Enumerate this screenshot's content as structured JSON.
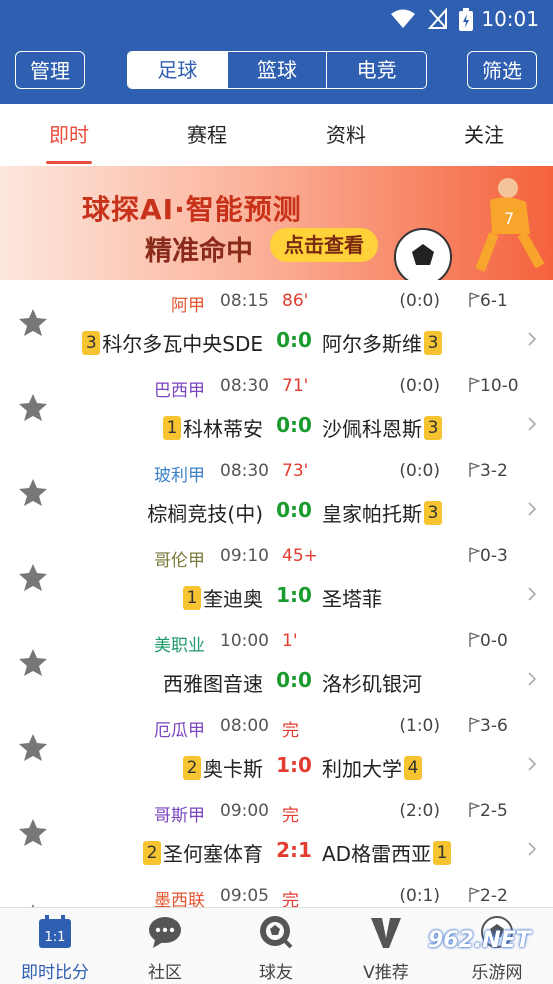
{
  "status_bar": {
    "time": "10:01"
  },
  "header": {
    "manage_label": "管理",
    "filter_label": "筛选",
    "sports": [
      "足球",
      "篮球",
      "电竞"
    ]
  },
  "tabs": [
    "即时",
    "赛程",
    "资料",
    "关注"
  ],
  "banner": {
    "line1": "球探AI·智能预测",
    "line2": "精准命中",
    "cta": "点击查看"
  },
  "matches": [
    {
      "league": "阿甲",
      "league_color": "#e2542f",
      "time": "08:15",
      "minute": "86'",
      "half": "(0:0)",
      "corner": "6-1",
      "home_badge": "3",
      "home": "科尔多瓦中央SDE",
      "score": "0:0",
      "away": "阿尔多斯维",
      "away_badge": "3",
      "finished": false
    },
    {
      "league": "巴西甲",
      "league_color": "#7b45c0",
      "time": "08:30",
      "minute": "71'",
      "half": "(0:0)",
      "corner": "10-0",
      "home_badge": "1",
      "home": "科林蒂安",
      "score": "0:0",
      "away": "沙佩科恩斯",
      "away_badge": "3",
      "finished": false
    },
    {
      "league": "玻利甲",
      "league_color": "#3c82c8",
      "time": "08:30",
      "minute": "73'",
      "half": "(0:0)",
      "corner": "3-2",
      "home_badge": "",
      "home": "棕榈竞技(中)",
      "score": "0:0",
      "away": "皇家帕托斯",
      "away_badge": "3",
      "finished": false
    },
    {
      "league": "哥伦甲",
      "league_color": "#7a7a3a",
      "time": "09:10",
      "minute": "45+",
      "half": "",
      "corner": "0-3",
      "home_badge": "1",
      "home": "奎迪奥",
      "score": "1:0",
      "away": "圣塔菲",
      "away_badge": "",
      "finished": false
    },
    {
      "league": "美职业",
      "league_color": "#1e9a6a",
      "time": "10:00",
      "minute": "1'",
      "half": "",
      "corner": "0-0",
      "home_badge": "",
      "home": "西雅图音速",
      "score": "0:0",
      "away": "洛杉矶银河",
      "away_badge": "",
      "finished": false
    },
    {
      "league": "厄瓜甲",
      "league_color": "#7b45c0",
      "time": "08:00",
      "minute": "完",
      "half": "(1:0)",
      "corner": "3-6",
      "home_badge": "2",
      "home": "奥卡斯",
      "score": "1:0",
      "away": "利加大学",
      "away_badge": "4",
      "finished": true
    },
    {
      "league": "哥斯甲",
      "league_color": "#7b45c0",
      "time": "09:00",
      "minute": "完",
      "half": "(2:0)",
      "corner": "2-5",
      "home_badge": "2",
      "home": "圣何塞体育",
      "score": "2:1",
      "away": "AD格雷西亚",
      "away_badge": "1",
      "finished": true
    },
    {
      "league": "墨西联",
      "league_color": "#e2542f",
      "time": "09:05",
      "minute": "完",
      "half": "(0:1)",
      "corner": "2-2",
      "home_badge": "",
      "home": "",
      "score": "",
      "away": "",
      "away_badge": "",
      "finished": true
    }
  ],
  "bottom_nav": [
    "即时比分",
    "社区",
    "球友",
    "V推荐",
    "乐游网"
  ],
  "calendar_icon_text": "1:1",
  "watermark": "962.NET"
}
